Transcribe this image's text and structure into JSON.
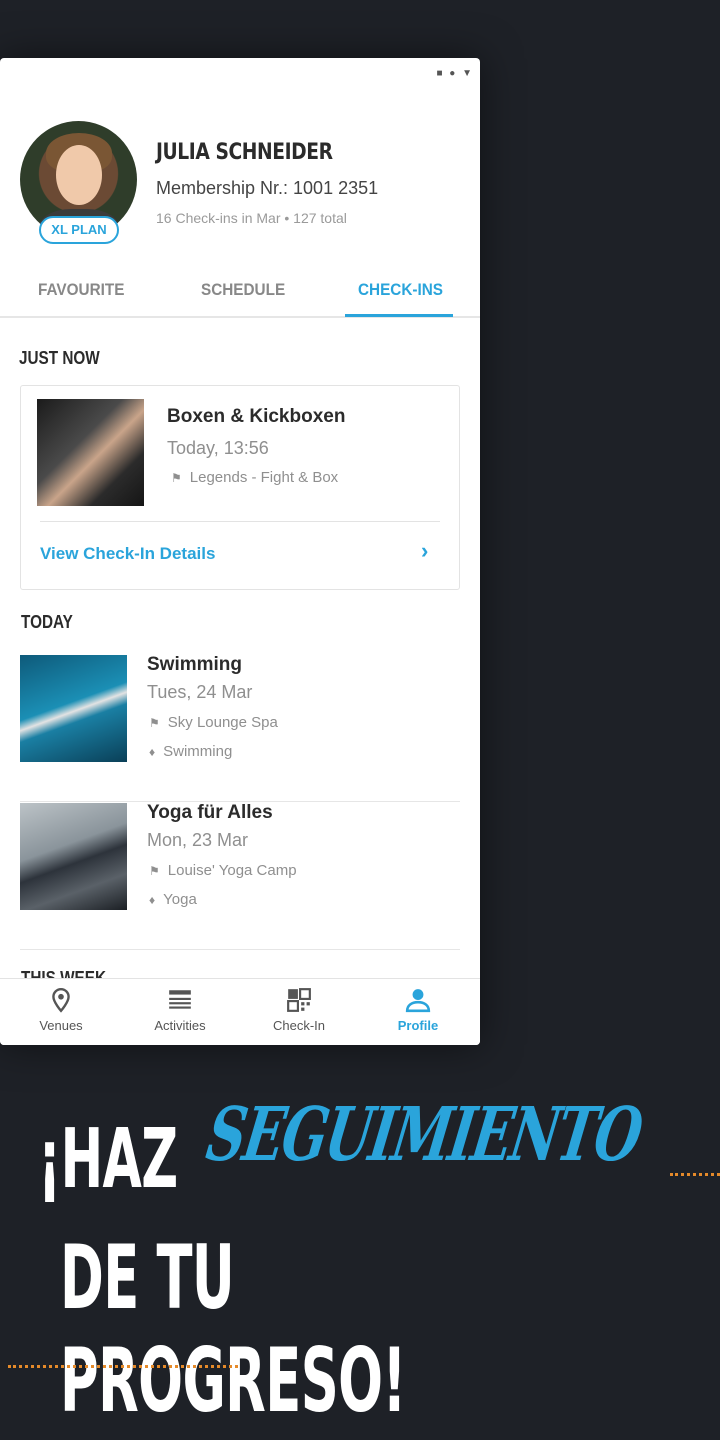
{
  "profile": {
    "name": "JULIA SCHNEIDER",
    "membership": "Membership Nr.: 1001 2351",
    "checkins_summary": "16 Check-ins in Mar • 127 total",
    "plan_badge": "XL PLAN"
  },
  "tabs": [
    {
      "label": "FAVOURITE",
      "active": false
    },
    {
      "label": "SCHEDULE",
      "active": false
    },
    {
      "label": "CHECK-INS",
      "active": true
    }
  ],
  "just_now": {
    "title": "JUST NOW",
    "card": {
      "activity": "Boxen & Kickboxen",
      "time": "Today, 13:56",
      "venue": "Legends - Fight & Box",
      "link_label": "View Check-In Details"
    }
  },
  "today": {
    "title": "TODAY",
    "items": [
      {
        "activity": "Swimming",
        "date": "Tues, 24 Mar",
        "venue": "Sky Lounge Spa",
        "tag": "Swimming"
      },
      {
        "activity": "Yoga für Alles",
        "date": "Mon, 23 Mar",
        "venue": "Louise' Yoga Camp",
        "tag": "Yoga"
      }
    ]
  },
  "this_week": {
    "title": "THIS WEEK"
  },
  "nav": [
    {
      "label": "Venues",
      "icon": "location-pin-icon",
      "active": false
    },
    {
      "label": "Activities",
      "icon": "list-icon",
      "active": false
    },
    {
      "label": "Check-In",
      "icon": "qr-code-icon",
      "active": false
    },
    {
      "label": "Profile",
      "icon": "profile-icon",
      "active": true
    }
  ],
  "promo": {
    "line1": "¡HAZ",
    "script": "SEGUIMIENTO",
    "line2": "DE TU PROGRESO!"
  },
  "colors": {
    "accent": "#2aa4db",
    "background": "#1e2127",
    "dots": "#e58a2a"
  }
}
